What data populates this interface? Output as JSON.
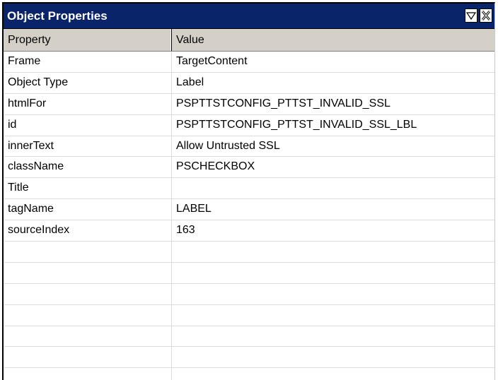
{
  "window": {
    "title": "Object Properties",
    "dropdown_icon": "triangle-down-icon",
    "close_icon": "close-x-icon"
  },
  "table": {
    "headers": {
      "property": "Property",
      "value": "Value"
    },
    "rows": [
      {
        "property": "Frame",
        "value": "TargetContent"
      },
      {
        "property": "Object Type",
        "value": "Label"
      },
      {
        "property": "htmlFor",
        "value": "PSPTTSTCONFIG_PTTST_INVALID_SSL"
      },
      {
        "property": "id",
        "value": "PSPTTSTCONFIG_PTTST_INVALID_SSL_LBL"
      },
      {
        "property": "innerText",
        "value": "Allow Untrusted SSL"
      },
      {
        "property": "className",
        "value": "PSCHECKBOX"
      },
      {
        "property": "Title",
        "value": ""
      },
      {
        "property": "tagName",
        "value": "LABEL"
      },
      {
        "property": "sourceIndex",
        "value": "163"
      },
      {
        "property": "",
        "value": ""
      },
      {
        "property": "",
        "value": ""
      },
      {
        "property": "",
        "value": ""
      },
      {
        "property": "",
        "value": ""
      },
      {
        "property": "",
        "value": ""
      },
      {
        "property": "",
        "value": ""
      },
      {
        "property": "",
        "value": ""
      }
    ]
  },
  "colors": {
    "titlebar": "#0a246a",
    "header": "#d4d0c8",
    "grid_line": "#dcdcdc"
  }
}
